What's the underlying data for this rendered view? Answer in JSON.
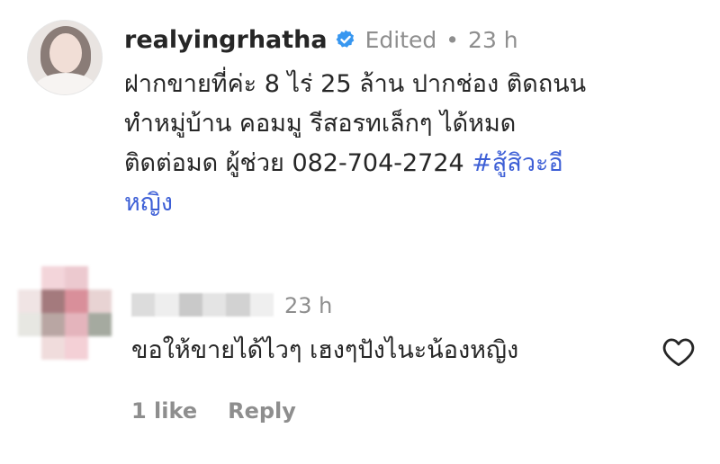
{
  "comment": {
    "username": "realyingrhatha",
    "verified_icon": "verified-badge-icon",
    "edited_label": "Edited",
    "separator": "•",
    "time": "23 h",
    "text_lines": [
      "ฝากขายที่ค่ะ 8 ไร่ 25 ล้าน ปากช่อง ติดถนน",
      "ทำหมู่บ้าน คอมมู รีสอรทเล็กๆ ได้หมด",
      "ติดต่อมด ผู้ช่วย 082-704-2724 "
    ],
    "hashtag_part1": "#สู้สิวะอี",
    "hashtag_part2": "หญิง",
    "hashtag_color": "#3d5fd6"
  },
  "reply": {
    "time": "23 h",
    "text": "ขอให้ขายได้ไวๆ เฮงๆปังไนะน้องหญิง",
    "likes_label": "1 like",
    "reply_label": "Reply",
    "like_icon": "heart-icon"
  },
  "colors": {
    "text": "#262626",
    "muted": "#8e8e8e",
    "verified": "#3897f0",
    "link": "#3d5fd6"
  }
}
